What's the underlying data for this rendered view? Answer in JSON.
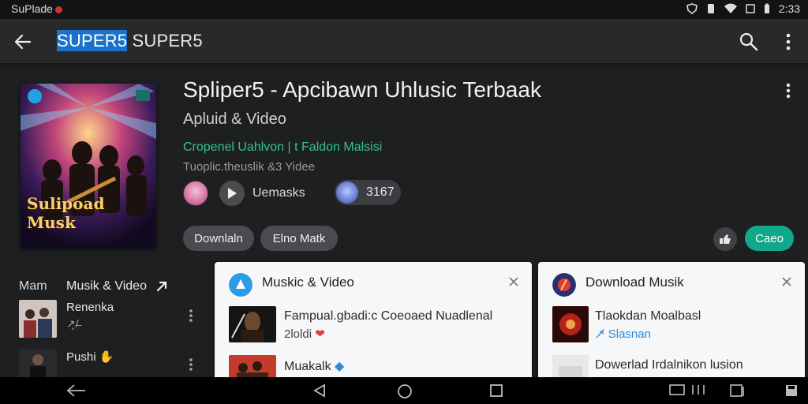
{
  "status_bar": {
    "app_label": "SuPlade",
    "time": "2:33"
  },
  "app_bar": {
    "title_selected": "SUPER5",
    "title_rest": " SUPER5"
  },
  "header": {
    "title": "Spliper5 - Apcibawn Uhlusic Terbaak",
    "subtitle": "Apluid & Video",
    "green_line": "Cropenel Uahlvon | t Faldon Malsisi",
    "gray_line": "Tuoplic.theuslik &3 Yidee",
    "cover_text": "Sulipoad Musk",
    "chip_label": "Uemasks",
    "count": "3167"
  },
  "actions": {
    "download": "Downlaln",
    "elno": "Elno Matk",
    "green_button": "Caeo"
  },
  "list": {
    "head_a": "Mam",
    "head_b": "Musik & Video",
    "items": [
      {
        "title": "Renenka",
        "sub": "↗̧/̶"
      },
      {
        "title": "Pushi",
        "sub": ""
      }
    ]
  },
  "cards": [
    {
      "title": "Muskic & Video",
      "items": [
        {
          "title": "Fampual.gbadi:c Coeoaed Nuadlenal",
          "sub": "2loldi",
          "heart": "❤"
        },
        {
          "title": "Muakalk",
          "sub": ""
        }
      ]
    },
    {
      "title": "Download Musik",
      "items": [
        {
          "title": "Tlaokdan Moalbasl",
          "sub": "↗̸ Slasnan"
        },
        {
          "title": "Dowerlad Irdalnikon lusion",
          "sub": ""
        }
      ]
    }
  ],
  "colors": {
    "accent_green": "#11a88a",
    "selection_blue": "#1a73c9",
    "text_green": "#35c391"
  }
}
